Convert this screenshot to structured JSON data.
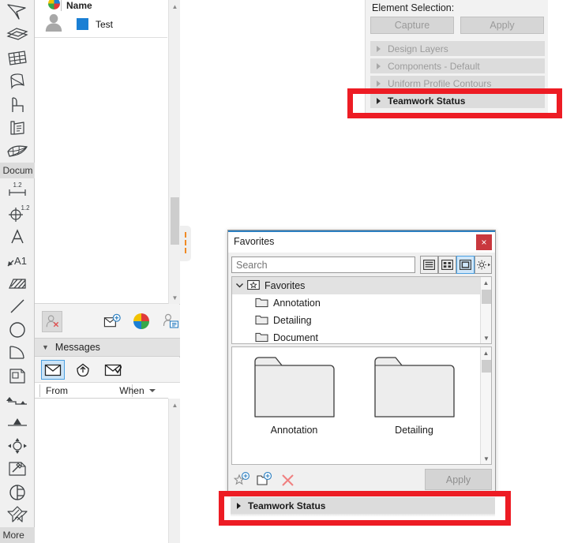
{
  "colors": {
    "highlight_red": "#ED1C24",
    "accent_blue": "#1a7fd4",
    "title_accent": "#2b7fc1",
    "close_red": "#c9383e",
    "selected_blue_fill": "#cfe6f9",
    "splitter_orange": "#f08a24"
  },
  "tool_palette": {
    "items": [
      {
        "name": "arrow-pointer-tool",
        "icon": "arrow-pointer-icon"
      },
      {
        "name": "layers-tool",
        "icon": "layers-icon"
      },
      {
        "name": "grid-mesh-tool",
        "icon": "grid-mesh-icon"
      },
      {
        "name": "shell-tool",
        "icon": "shell-icon"
      },
      {
        "name": "object-chair-tool",
        "icon": "chair-icon"
      },
      {
        "name": "door-tool",
        "icon": "door-icon"
      },
      {
        "name": "mesh-surface-tool",
        "icon": "mesh-surface-icon"
      }
    ],
    "tab_document_label": "Docum",
    "items2": [
      {
        "name": "linear-dimension-tool",
        "icon": "dimension-icon",
        "badge": "1.2"
      },
      {
        "name": "radial-dimension-tool",
        "icon": "radial-dimension-icon",
        "badge": "1.2"
      },
      {
        "name": "text-tool",
        "icon": "text-a-icon"
      },
      {
        "name": "label-tool",
        "icon": "label-a1-icon"
      },
      {
        "name": "fill-hatch-tool",
        "icon": "hatch-fill-icon"
      },
      {
        "name": "line-tool",
        "icon": "line-icon"
      },
      {
        "name": "circle-tool",
        "icon": "circle-icon"
      },
      {
        "name": "arc-tool",
        "icon": "arc-icon"
      },
      {
        "name": "figure-drawing-tool",
        "icon": "figure-icon"
      },
      {
        "name": "section-tool",
        "icon": "section-icon"
      },
      {
        "name": "elevation-tool",
        "icon": "elevation-icon"
      },
      {
        "name": "detail-marker-tool",
        "icon": "detail-marker-icon"
      },
      {
        "name": "worksheet-tool",
        "icon": "worksheet-icon"
      },
      {
        "name": "camera-tool",
        "icon": "camera-view-icon"
      },
      {
        "name": "3d-document-tool",
        "icon": "cube-3d-icon"
      }
    ],
    "tab_more_label": "More"
  },
  "teamwork_panel": {
    "user_list": {
      "column_header": "Name",
      "column_header_icon": "pie-chart-icon",
      "rows": [
        {
          "avatar_icon": "user-silhouette-icon",
          "color": "#1a7fd4",
          "label": "Test"
        }
      ]
    },
    "toolbar": [
      {
        "name": "remove-user-button",
        "icon": "user-remove-icon",
        "disabled": true
      },
      {
        "name": "send-message-button",
        "icon": "envelope-plus-icon"
      },
      {
        "name": "reservation-pie-button",
        "icon": "color-pie-icon"
      },
      {
        "name": "user-details-button",
        "icon": "user-card-icon"
      }
    ],
    "messages": {
      "section_title": "Messages",
      "caret": "▼",
      "tabs": [
        {
          "name": "inbox-tab",
          "icon": "envelope-icon",
          "selected": true
        },
        {
          "name": "outbox-tab",
          "icon": "envelope-up-icon",
          "selected": false
        },
        {
          "name": "read-tab",
          "icon": "envelope-check-icon",
          "selected": false
        }
      ],
      "columns": [
        {
          "label": "From"
        },
        {
          "label": "When",
          "sort_icon": "caret-down-icon"
        }
      ],
      "rows": []
    }
  },
  "info_panel": {
    "title": "Element Selection:",
    "buttons": [
      {
        "name": "capture-button",
        "label": "Capture",
        "disabled": true
      },
      {
        "name": "apply-button",
        "label": "Apply",
        "disabled": true
      }
    ],
    "accordion": [
      {
        "label": "Design Layers",
        "active": false
      },
      {
        "label": "Components - Default",
        "active": false
      },
      {
        "label": "Uniform Profile Contours",
        "active": false
      },
      {
        "label": "Teamwork Status",
        "active": true
      }
    ]
  },
  "favorites_dialog": {
    "title": "Favorites",
    "close_label": "×",
    "search": {
      "placeholder": "Search",
      "value": ""
    },
    "view_buttons": [
      {
        "name": "list-view-button",
        "icon": "list-view-icon",
        "selected": false
      },
      {
        "name": "tile-view-button",
        "icon": "tile-view-icon",
        "selected": false
      },
      {
        "name": "large-icon-view-button",
        "icon": "large-icon-view-icon",
        "selected": true
      },
      {
        "name": "settings-button",
        "icon": "gear-icon",
        "selected": false
      }
    ],
    "tree": [
      {
        "label": "Favorites",
        "icon": "favorites-star-folder-icon",
        "level": 0,
        "expanded": true,
        "selected": true
      },
      {
        "label": "Annotation",
        "icon": "folder-icon",
        "level": 1,
        "expanded": false,
        "selected": false
      },
      {
        "label": "Detailing",
        "icon": "folder-icon",
        "level": 1,
        "expanded": false,
        "selected": false
      },
      {
        "label": "Document",
        "icon": "folder-icon",
        "level": 1,
        "expanded": false,
        "selected": false
      }
    ],
    "grid_items": [
      {
        "label": "Annotation",
        "icon": "folder-large-icon"
      },
      {
        "label": "Detailing",
        "icon": "folder-large-icon"
      }
    ],
    "bottom_buttons": [
      {
        "name": "new-favorite-button",
        "icon": "star-plus-icon"
      },
      {
        "name": "new-folder-button",
        "icon": "folder-plus-icon"
      },
      {
        "name": "delete-button",
        "icon": "close-x-icon"
      }
    ],
    "apply_button": {
      "label": "Apply",
      "disabled": true
    }
  },
  "bottom_teamwork_bar": {
    "label": "Teamwork Status",
    "caret": "▶"
  }
}
